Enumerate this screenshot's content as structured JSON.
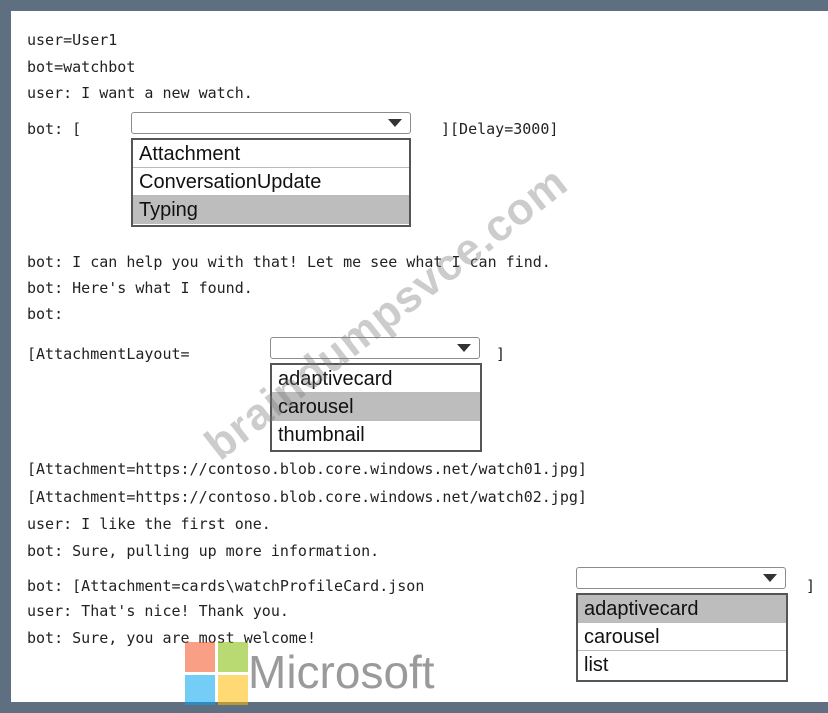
{
  "lines": {
    "l1": "user=User1",
    "l2": "bot=watchbot",
    "l3": "user: I want a new watch.",
    "l4a": "bot: [",
    "l4b": "][Delay=3000]",
    "l5": "bot: I can help you with that! Let me see what I can find.",
    "l6": "bot: Here's what I found.",
    "l7": "bot:",
    "l8a": "[AttachmentLayout=",
    "l8b": "]",
    "l9": "[Attachment=https://contoso.blob.core.windows.net/watch01.jpg]",
    "l10": "[Attachment=https://contoso.blob.core.windows.net/watch02.jpg]",
    "l11": "user: I like the first one.",
    "l12": "bot: Sure, pulling up more information.",
    "l13a": "bot: [Attachment=cards\\watchProfileCard.json",
    "l13b": "]",
    "l14": "user: That's nice! Thank you.",
    "l15": "bot: Sure, you are most welcome!"
  },
  "dropdown1": {
    "options": [
      "Attachment",
      "ConversationUpdate",
      "Typing"
    ],
    "selected": "Typing"
  },
  "dropdown2": {
    "options": [
      "adaptivecard",
      "carousel",
      "thumbnail"
    ],
    "selected": "carousel"
  },
  "dropdown3": {
    "options": [
      "adaptivecard",
      "carousel",
      "list"
    ],
    "selected": "adaptivecard"
  },
  "watermark": "braindumpsvce.com",
  "logo": {
    "text": "Microsoft",
    "colors": {
      "red": "#f25022",
      "green": "#7fba00",
      "blue": "#00a4ef",
      "yellow": "#ffb900"
    }
  }
}
